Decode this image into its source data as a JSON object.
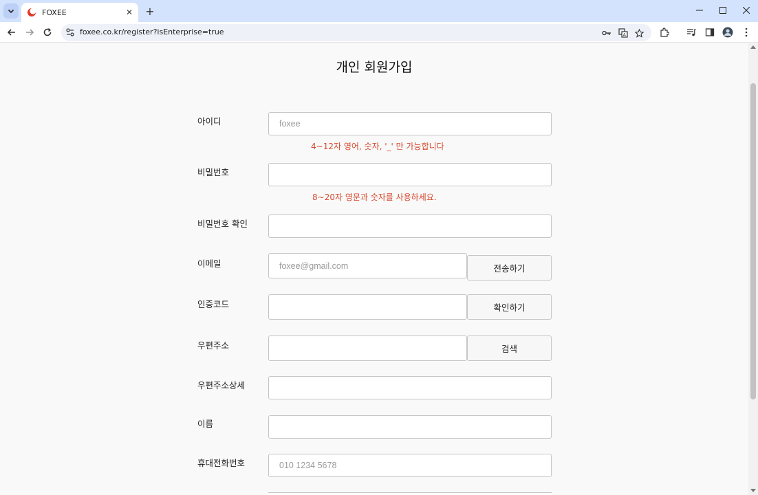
{
  "browser": {
    "tab_title": "FOXEE",
    "url": "foxee.co.kr/register?isEnterprise=true",
    "new_tab_symbol": "+",
    "tab_close_symbol": "✕"
  },
  "page": {
    "heading": "개인 회원가입",
    "fields": {
      "id": {
        "label": "아이디",
        "placeholder": "foxee",
        "hint": "4~12자 영어, 숫자, '_' 만 가능합니다"
      },
      "password": {
        "label": "비밀번호",
        "hint": "8~20자 영문과 숫자를 사용하세요."
      },
      "password_confirm": {
        "label": "비밀번호 확인"
      },
      "email": {
        "label": "이메일",
        "placeholder": "foxee@gmail.com",
        "button": "전송하기"
      },
      "auth_code": {
        "label": "인증코드",
        "button": "확인하기"
      },
      "zipcode": {
        "label": "우편주소",
        "button": "검색"
      },
      "address_detail": {
        "label": "우편주소상세"
      },
      "name": {
        "label": "이름"
      },
      "phone": {
        "label": "휴대전화번호",
        "placeholder": "010 1234 5678"
      }
    }
  },
  "colors": {
    "hint": "#d64a2f",
    "tabstrip": "#d3e3fd"
  }
}
